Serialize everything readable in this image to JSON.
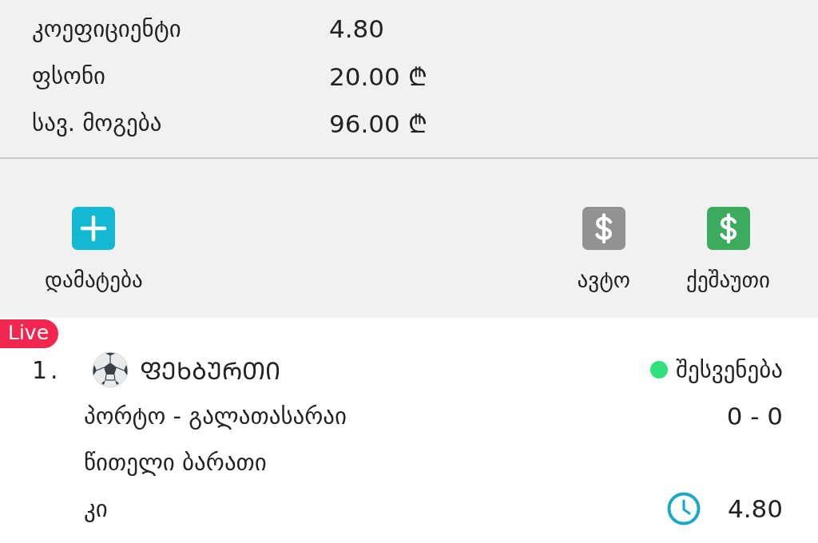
{
  "summary": [
    {
      "label": "კოეფიციენტი",
      "value": "4.80"
    },
    {
      "label": "ფსონი",
      "value": "20.00 ₾"
    },
    {
      "label": "სავ. მოგება",
      "value": "96.00 ₾"
    }
  ],
  "actions": [
    {
      "kind": "add",
      "label": "დამატება",
      "color": "#13b9d2"
    },
    {
      "kind": "auto",
      "label": "ავტო",
      "color": "#929292"
    },
    {
      "kind": "cashout",
      "label": "ქეშაუთი",
      "color": "#3cab5e"
    }
  ],
  "bets": [
    {
      "live_badge": "Live",
      "number": "1.",
      "sport": "ᲤᲔᲮᲑᲣᲠᲗᲘ",
      "status": {
        "label": "შესვენება",
        "color": "#2fe07c"
      },
      "match": "პორტო - გალათასარაი",
      "score": "0 - 0",
      "market": "წითელი ბარათი",
      "pick": "კი",
      "odds": "4.80"
    }
  ]
}
